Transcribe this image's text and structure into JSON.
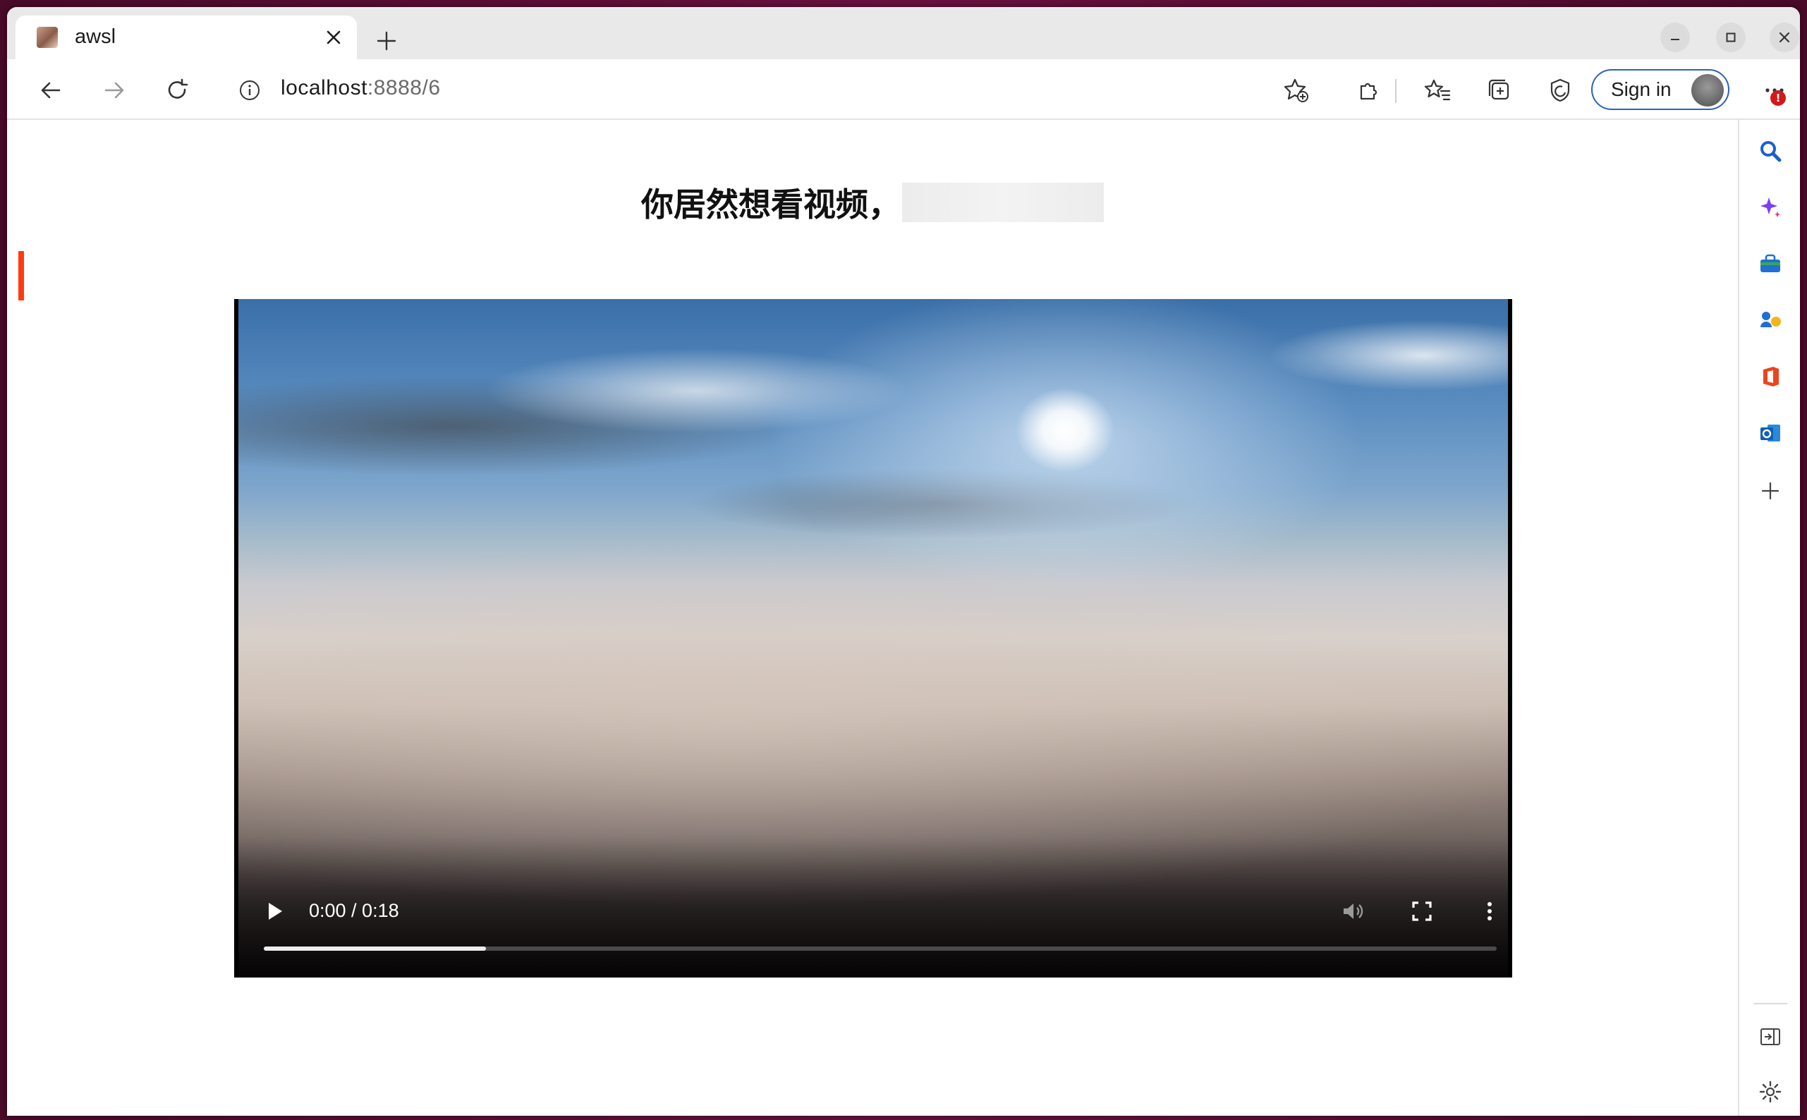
{
  "browser": {
    "tab": {
      "title": "awsl",
      "favicon": "tab-favicon"
    },
    "address": {
      "host": "localhost",
      "port_path": ":8888/6"
    },
    "signin_label": "Sign in",
    "notification_badge": "!",
    "colors": {
      "accent_blue": "#2b63b8",
      "badge_red": "#d21a1a"
    }
  },
  "page": {
    "heading": "你居然想看视频，",
    "accent_color": "#ff3b12"
  },
  "video": {
    "time_display": "0:00 / 0:18",
    "progress": 0.18,
    "muted": true
  },
  "sidebar": {
    "items": [
      "search-icon",
      "copilot-icon",
      "shopping-icon",
      "games-icon",
      "office-icon",
      "outlook-icon",
      "add-icon"
    ],
    "bottom": [
      "split-screen-icon",
      "settings-icon"
    ]
  }
}
